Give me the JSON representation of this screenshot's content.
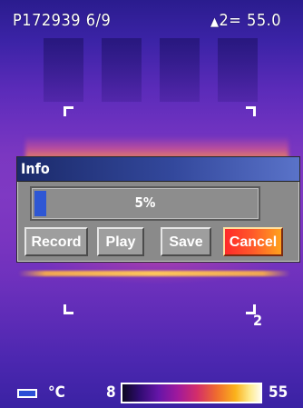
{
  "header": {
    "file_label": "P172939",
    "file_index": "6/9",
    "marker_symbol": "▲",
    "marker_value": "2= 55.0"
  },
  "markers": {
    "spot_number": "2"
  },
  "dialog": {
    "title": "Info",
    "progress_text": "5%",
    "progress_fraction": 0.05,
    "buttons": {
      "record": "Record",
      "play": "Play",
      "save": "Save",
      "cancel": "Cancel"
    }
  },
  "bottom_bar": {
    "unit": "°C",
    "scale_min": "8",
    "scale_max": "55",
    "icons": {
      "battery": "battery-icon",
      "thermometer": "thermometer-icon"
    }
  },
  "colors": {
    "dialog_title_left": "#1b2a6a",
    "dialog_title_right": "#5a73c9",
    "progress_fill": "#2e57d4",
    "cancel_start": "#ff2a2a",
    "cancel_end": "#ffa21d"
  }
}
